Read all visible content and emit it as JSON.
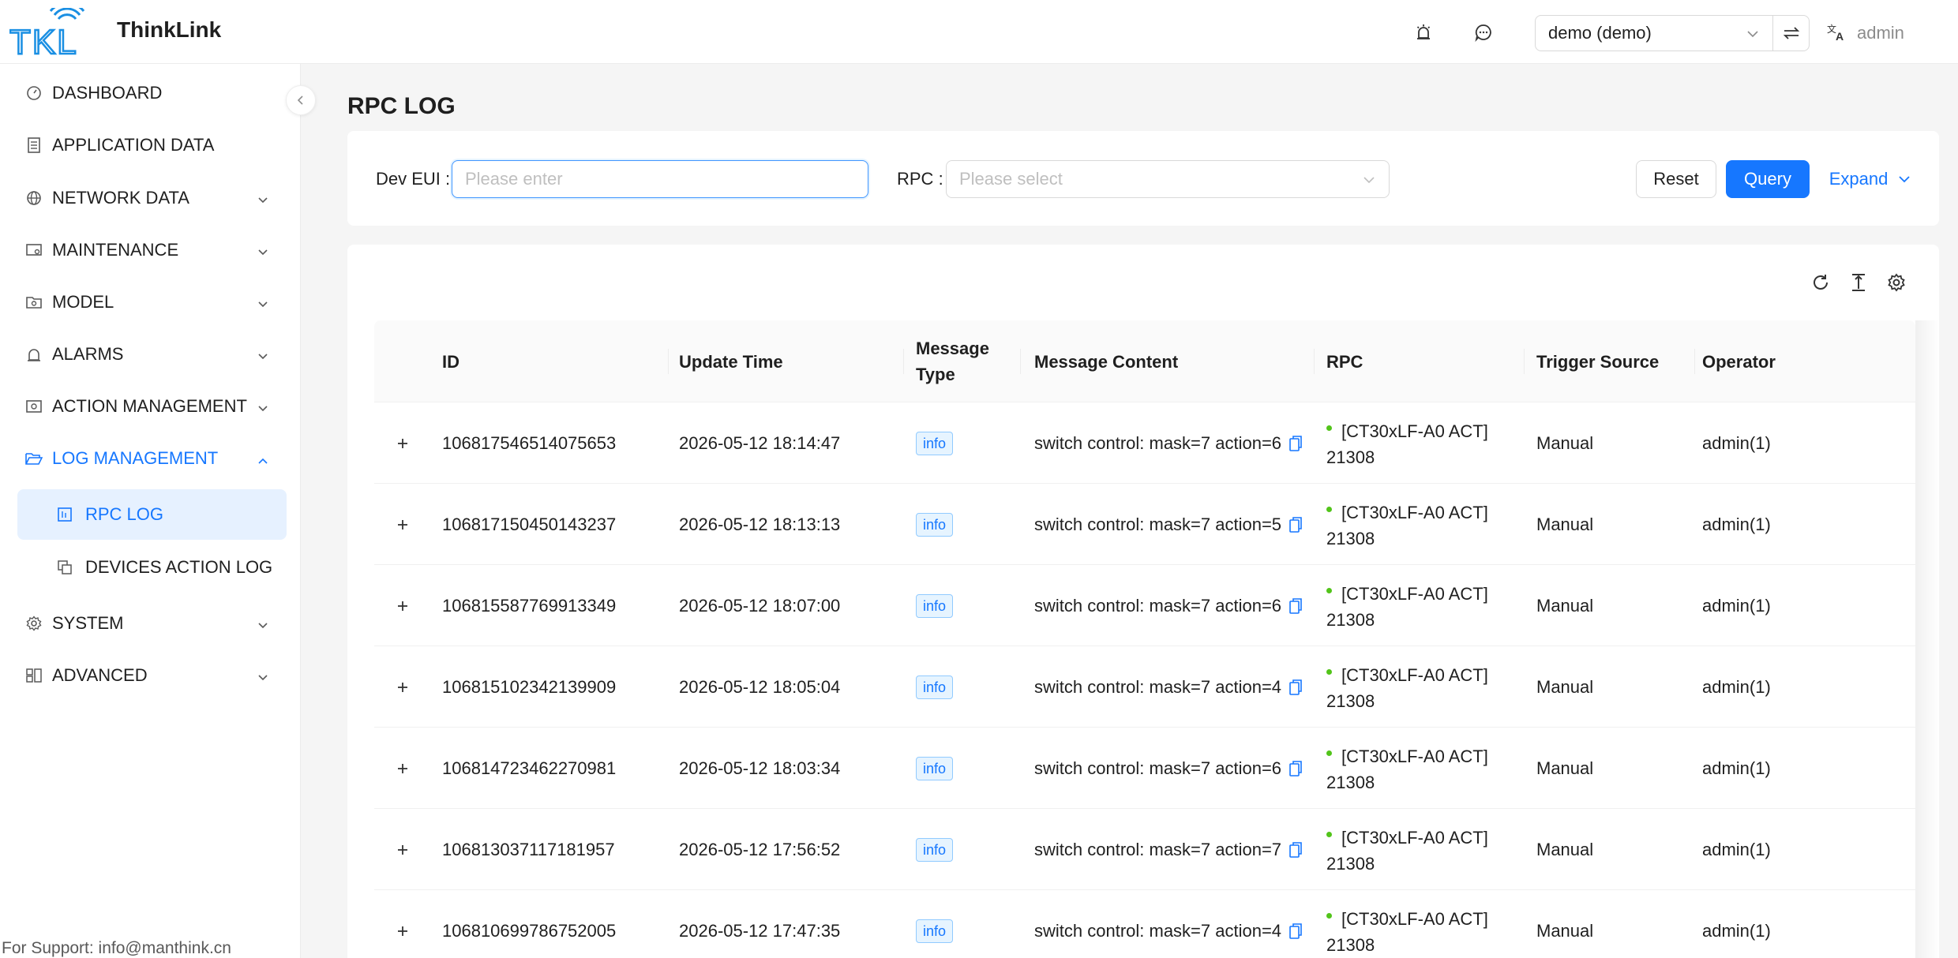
{
  "app": {
    "name": "ThinkLink",
    "logo_text": "TKL",
    "support": "For Support: info@manthink.cn"
  },
  "header": {
    "tenant": "demo (demo)",
    "user": "admin"
  },
  "sidebar": {
    "items": [
      {
        "label": "DASHBOARD"
      },
      {
        "label": "APPLICATION DATA"
      },
      {
        "label": "NETWORK DATA"
      },
      {
        "label": "MAINTENANCE"
      },
      {
        "label": "MODEL"
      },
      {
        "label": "ALARMS"
      },
      {
        "label": "ACTION MANAGEMENT"
      },
      {
        "label": "LOG MANAGEMENT"
      },
      {
        "label": "SYSTEM"
      },
      {
        "label": "ADVANCED"
      }
    ],
    "sub_items": [
      {
        "label": "RPC LOG"
      },
      {
        "label": "DEVICES ACTION LOG"
      }
    ]
  },
  "page": {
    "title": "RPC LOG"
  },
  "filters": {
    "dev_eui_label": "Dev EUI",
    "dev_eui_placeholder": "Please enter",
    "rpc_label": "RPC",
    "rpc_placeholder": "Please select",
    "reset": "Reset",
    "query": "Query",
    "expand": "Expand"
  },
  "table": {
    "columns": [
      "ID",
      "Update Time",
      "Message Type",
      "Message Content",
      "RPC",
      "Trigger Source",
      "Operator"
    ],
    "message_type_line1": "Message",
    "message_type_line2": "Type",
    "rows": [
      {
        "id": "106817546514075653",
        "time": "2026-05-12 18:14:47",
        "type": "info",
        "content": "switch control: mask=7 action=6",
        "rpc_line1": "[CT30xLF-A0 ACT]",
        "rpc_line2": "21308",
        "source": "Manual",
        "operator": "admin(1)"
      },
      {
        "id": "106817150450143237",
        "time": "2026-05-12 18:13:13",
        "type": "info",
        "content": "switch control: mask=7 action=5",
        "rpc_line1": "[CT30xLF-A0 ACT]",
        "rpc_line2": "21308",
        "source": "Manual",
        "operator": "admin(1)"
      },
      {
        "id": "106815587769913349",
        "time": "2026-05-12 18:07:00",
        "type": "info",
        "content": "switch control: mask=7 action=6",
        "rpc_line1": "[CT30xLF-A0 ACT]",
        "rpc_line2": "21308",
        "source": "Manual",
        "operator": "admin(1)"
      },
      {
        "id": "106815102342139909",
        "time": "2026-05-12 18:05:04",
        "type": "info",
        "content": "switch control: mask=7 action=4",
        "rpc_line1": "[CT30xLF-A0 ACT]",
        "rpc_line2": "21308",
        "source": "Manual",
        "operator": "admin(1)"
      },
      {
        "id": "106814723462270981",
        "time": "2026-05-12 18:03:34",
        "type": "info",
        "content": "switch control: mask=7 action=6",
        "rpc_line1": "[CT30xLF-A0 ACT]",
        "rpc_line2": "21308",
        "source": "Manual",
        "operator": "admin(1)"
      },
      {
        "id": "106813037117181957",
        "time": "2026-05-12 17:56:52",
        "type": "info",
        "content": "switch control: mask=7 action=7",
        "rpc_line1": "[CT30xLF-A0 ACT]",
        "rpc_line2": "21308",
        "source": "Manual",
        "operator": "admin(1)"
      },
      {
        "id": "106810699786752005",
        "time": "2026-05-12 17:47:35",
        "type": "info",
        "content": "switch control: mask=7 action=4",
        "rpc_line1": "[CT30xLF-A0 ACT]",
        "rpc_line2": "21308",
        "source": "Manual",
        "operator": "admin(1)"
      }
    ]
  }
}
